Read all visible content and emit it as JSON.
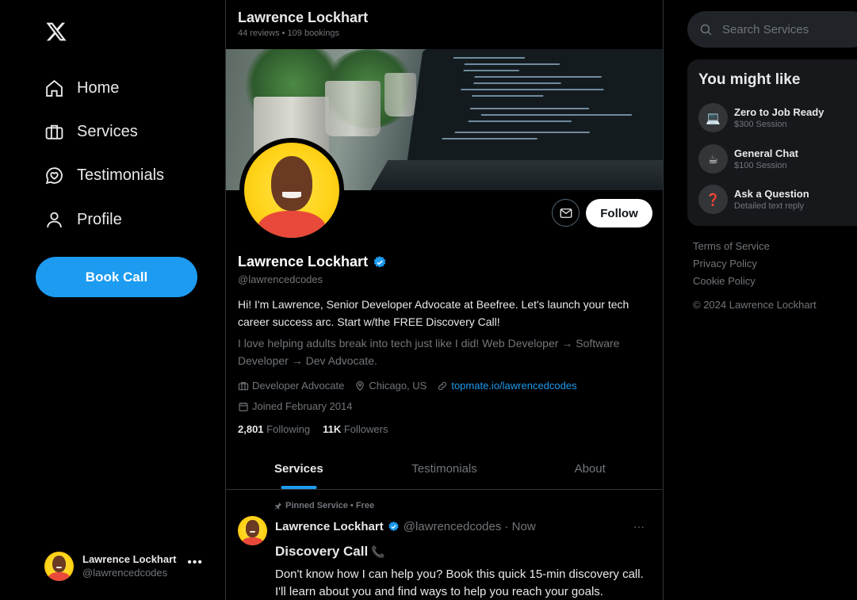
{
  "nav": {
    "items": [
      {
        "label": "Home",
        "icon": "home-icon"
      },
      {
        "label": "Services",
        "icon": "briefcase-icon"
      },
      {
        "label": "Testimonials",
        "icon": "heart-chat-icon"
      },
      {
        "label": "Profile",
        "icon": "person-icon"
      }
    ],
    "book_label": "Book Call"
  },
  "account": {
    "name": "Lawrence Lockhart",
    "handle": "@lawrencedcodes",
    "more": "•••"
  },
  "header": {
    "title": "Lawrence Lockhart",
    "subtitle": "44 reviews • 109 bookings"
  },
  "profile": {
    "name": "Lawrence Lockhart",
    "handle": "@lawrencedcodes",
    "follow_label": "Follow",
    "bio": "Hi! I'm Lawrence, Senior Developer Advocate at Beefree. Let's launch your tech career success arc. Start w/the FREE Discovery Call!",
    "bio_secondary": "I love helping adults break into tech just like I did! Web Developer → Software Developer → Dev Advocate.",
    "job": "Developer Advocate",
    "location": "Chicago, US",
    "link": "topmate.io/lawrencedcodes",
    "joined": "Joined February 2014",
    "following_count": "2,801",
    "following_label": "Following",
    "followers_count": "11K",
    "followers_label": "Followers"
  },
  "tabs": [
    {
      "label": "Services",
      "active": true
    },
    {
      "label": "Testimonials",
      "active": false
    },
    {
      "label": "About",
      "active": false
    }
  ],
  "post": {
    "pinned": "Pinned Service • Free",
    "name": "Lawrence Lockhart",
    "meta": "@lawrencedcodes · Now",
    "more": "···",
    "title": "Discovery Call",
    "title_emoji": "📞",
    "body": "Don't know how I can help you? Book this quick 15-min discovery call. I'll learn about you and find ways to help you reach your goals."
  },
  "search": {
    "placeholder": "Search Services"
  },
  "suggestions": {
    "title": "You might like",
    "items": [
      {
        "icon": "laptop-icon",
        "glyph": "💻",
        "title": "Zero to Job Ready",
        "sub": "$300 Session"
      },
      {
        "icon": "coffee-icon",
        "glyph": "☕",
        "title": "General Chat",
        "sub": "$100 Session"
      },
      {
        "icon": "question-icon",
        "glyph": "❓",
        "title": "Ask a Question",
        "sub": "Detailed text reply"
      }
    ]
  },
  "footer": {
    "terms": "Terms of Service",
    "privacy": "Privacy Policy",
    "cookie": "Cookie Policy",
    "copyright": "© 2024 Lawrence Lockhart"
  },
  "colors": {
    "accent": "#1d9bf0",
    "background": "#000000",
    "panel": "#16181c",
    "muted_text": "#71767b"
  }
}
